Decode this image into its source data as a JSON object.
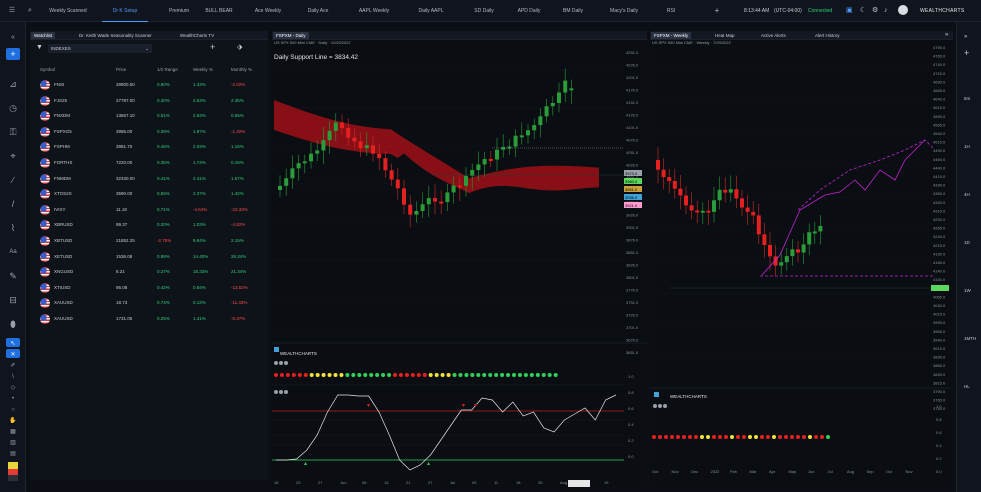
{
  "topbar": {
    "tabs": [
      "Weekly Scanned",
      "Dr K Setup",
      "Premium",
      "BULL BEAR",
      "Ace Weekly",
      "Daily Ace",
      "AAPL Weekly",
      "Daily AAPL",
      "SD Daily",
      "APD Daily",
      "BM Daily",
      "Macy's Daily",
      "RSI"
    ],
    "active_tab": 1,
    "time": "8:13:44 AM",
    "timezone": "(UTC-04:00)",
    "status": "Connected",
    "brand": "WEALTHCHARTS"
  },
  "watchlist": {
    "tab1": "Watchlist",
    "tab2": "Dr. Keith Wade Seasonality Scanner",
    "tab3": "WealthCharts TV",
    "list_name": "INDEXES",
    "headers": [
      "Symbol",
      "Price",
      "1/2 Range",
      "Weekly %",
      "Monthly %"
    ],
    "rows": [
      {
        "sym": "FNSI",
        "price": "28900.50",
        "r": "0.90%",
        "w": "1.33%",
        "m": "-2.02%",
        "mneg": true
      },
      {
        "sym": "FJS25",
        "price": "27787.00",
        "r": "0.30%",
        "w": "2.53%",
        "m": "2.35%"
      },
      {
        "sym": "FNXDM",
        "price": "13657.10",
        "r": "0.51%",
        "w": "2.53%",
        "m": "0.55%"
      },
      {
        "sym": "FSPXG5",
        "price": "3985.00",
        "r": "0.39%",
        "w": "1.87%",
        "m": "-1.32%",
        "mneg": true
      },
      {
        "sym": "FSPHM",
        "price": "3981.70",
        "r": "0.46%",
        "w": "2.03%",
        "m": "1.15%"
      },
      {
        "sym": "FORTHS",
        "price": "7220.00",
        "r": "0.35%",
        "w": "1.74%",
        "m": "0.16%"
      },
      {
        "sym": "FNMDM",
        "price": "32330.00",
        "r": "0.41%",
        "w": "2.41%",
        "m": "1.57%"
      },
      {
        "sym": "XTOS2S",
        "price": "3590.00",
        "r": "0.56%",
        "w": "2.37%",
        "m": "1.42%"
      },
      {
        "sym": "IVIXY",
        "price": "11.18",
        "r": "0.71%",
        "w": "-4.64%",
        "m": "-23.33%",
        "wneg": true,
        "mneg": true
      },
      {
        "sym": "XBRUSD",
        "price": "99.37",
        "r": "0.20%",
        "w": "1.03%",
        "m": "-4.82%",
        "mneg": true
      },
      {
        "sym": "XBTUSD",
        "price": "21852.25",
        "r": "-2.75%",
        "w": "9.84%",
        "m": "2.15%",
        "rneg": true
      },
      {
        "sym": "XETUSD",
        "price": "1536.08",
        "r": "0.98%",
        "w": "14.40%",
        "m": "26.34%"
      },
      {
        "sym": "XNGUSD",
        "price": "8.21",
        "r": "0.27%",
        "w": "15.33%",
        "m": "21.34%"
      },
      {
        "sym": "XTIUSD",
        "price": "95.08",
        "r": "0.42%",
        "w": "0.84%",
        "m": "-13.52%",
        "mneg": true
      },
      {
        "sym": "XAUUSD",
        "price": "18.73",
        "r": "0.74%",
        "w": "0.12%",
        "m": "-11.43%",
        "mneg": true
      },
      {
        "sym": "XAUUSD",
        "price": "1731.05",
        "r": "0.25%",
        "w": "1.41%",
        "m": "-0.37%",
        "mneg": true
      }
    ]
  },
  "chart1": {
    "tab": "FSPXM - Daily",
    "subtitle": "US SPX 500 Mini CME · Daily · 11/03/2022",
    "annotation": "Daily Support Line = 3834.42",
    "price_labels": [
      "4251.0",
      "4226.0",
      "4201.0",
      "4176.0",
      "4151.0",
      "4126.0",
      "4101.0",
      "4076.0",
      "4051.0",
      "4026.0",
      "4001.0",
      "3976.0",
      "3951.0",
      "3926.0",
      "3901.0",
      "3876.0",
      "3851.0",
      "3826.0",
      "3801.0",
      "3776.0",
      "3751.0",
      "3726.0",
      "3701.0",
      "3676.0",
      "3651.0"
    ],
    "boxes": [
      {
        "v": "3973.0",
        "c": "#9aa0aa"
      },
      {
        "v": "3960.0",
        "c": "#5cd65c"
      },
      {
        "v": "3951.0",
        "c": "#c8a13b"
      },
      {
        "v": "3936.0",
        "c": "#3fa2d6"
      },
      {
        "v": "3921.0",
        "c": "#ff9bd0"
      }
    ],
    "dates": [
      "16",
      "23",
      "27",
      "Jun",
      "06",
      "13",
      "21",
      "27",
      "Jul",
      "05",
      "11",
      "18",
      "25",
      "Aug",
      "08",
      "15"
    ],
    "brand": "WEALTHCHARTS",
    "osc_levels": [
      "1.0",
      "0.8",
      "0.6",
      "0.4",
      "0.2",
      "0.0"
    ]
  },
  "chart2": {
    "tab1": "FSPXM - Weekly",
    "tab2": "Heat Map",
    "tab3": "Active Alerts",
    "tab4": "Alert History",
    "subtitle": "US SPX 500 Mini CME · Weekly · 7/29/2022",
    "price_labels": [
      "4790.0",
      "4765.0",
      "4740.0",
      "4715.0",
      "4690.0",
      "4665.0",
      "4640.0",
      "4615.0",
      "4590.0",
      "4565.0",
      "4540.0",
      "4515.0",
      "4490.0",
      "4465.0",
      "4440.0",
      "4415.0",
      "4390.0",
      "4365.0",
      "4340.0",
      "4315.0",
      "4290.0",
      "4265.0",
      "4240.0",
      "4215.0",
      "4190.0",
      "4165.0",
      "4140.0",
      "4115.0",
      "4090.0",
      "4065.0",
      "4040.0",
      "4015.0",
      "3990.0",
      "3965.0",
      "3940.0",
      "3915.0",
      "3890.0",
      "3865.0",
      "3840.0",
      "3815.0",
      "3790.0",
      "3765.0",
      "3740.0"
    ],
    "dates": [
      "Oct",
      "Nov",
      "Dec",
      "2022",
      "Feb",
      "Mar",
      "Apr",
      "May",
      "Jun",
      "Jul",
      "Aug",
      "Sep",
      "Oct",
      "Nov"
    ],
    "brand": "WEALTHCHARTS",
    "osc_levels": [
      "1.0",
      "0.8",
      "0.6",
      "0.4",
      "0.2",
      "0.0"
    ]
  },
  "rightbar": {
    "items": [
      "5m",
      "1H",
      "4H",
      "1D",
      "1W",
      "1MTH",
      "HL"
    ]
  }
}
